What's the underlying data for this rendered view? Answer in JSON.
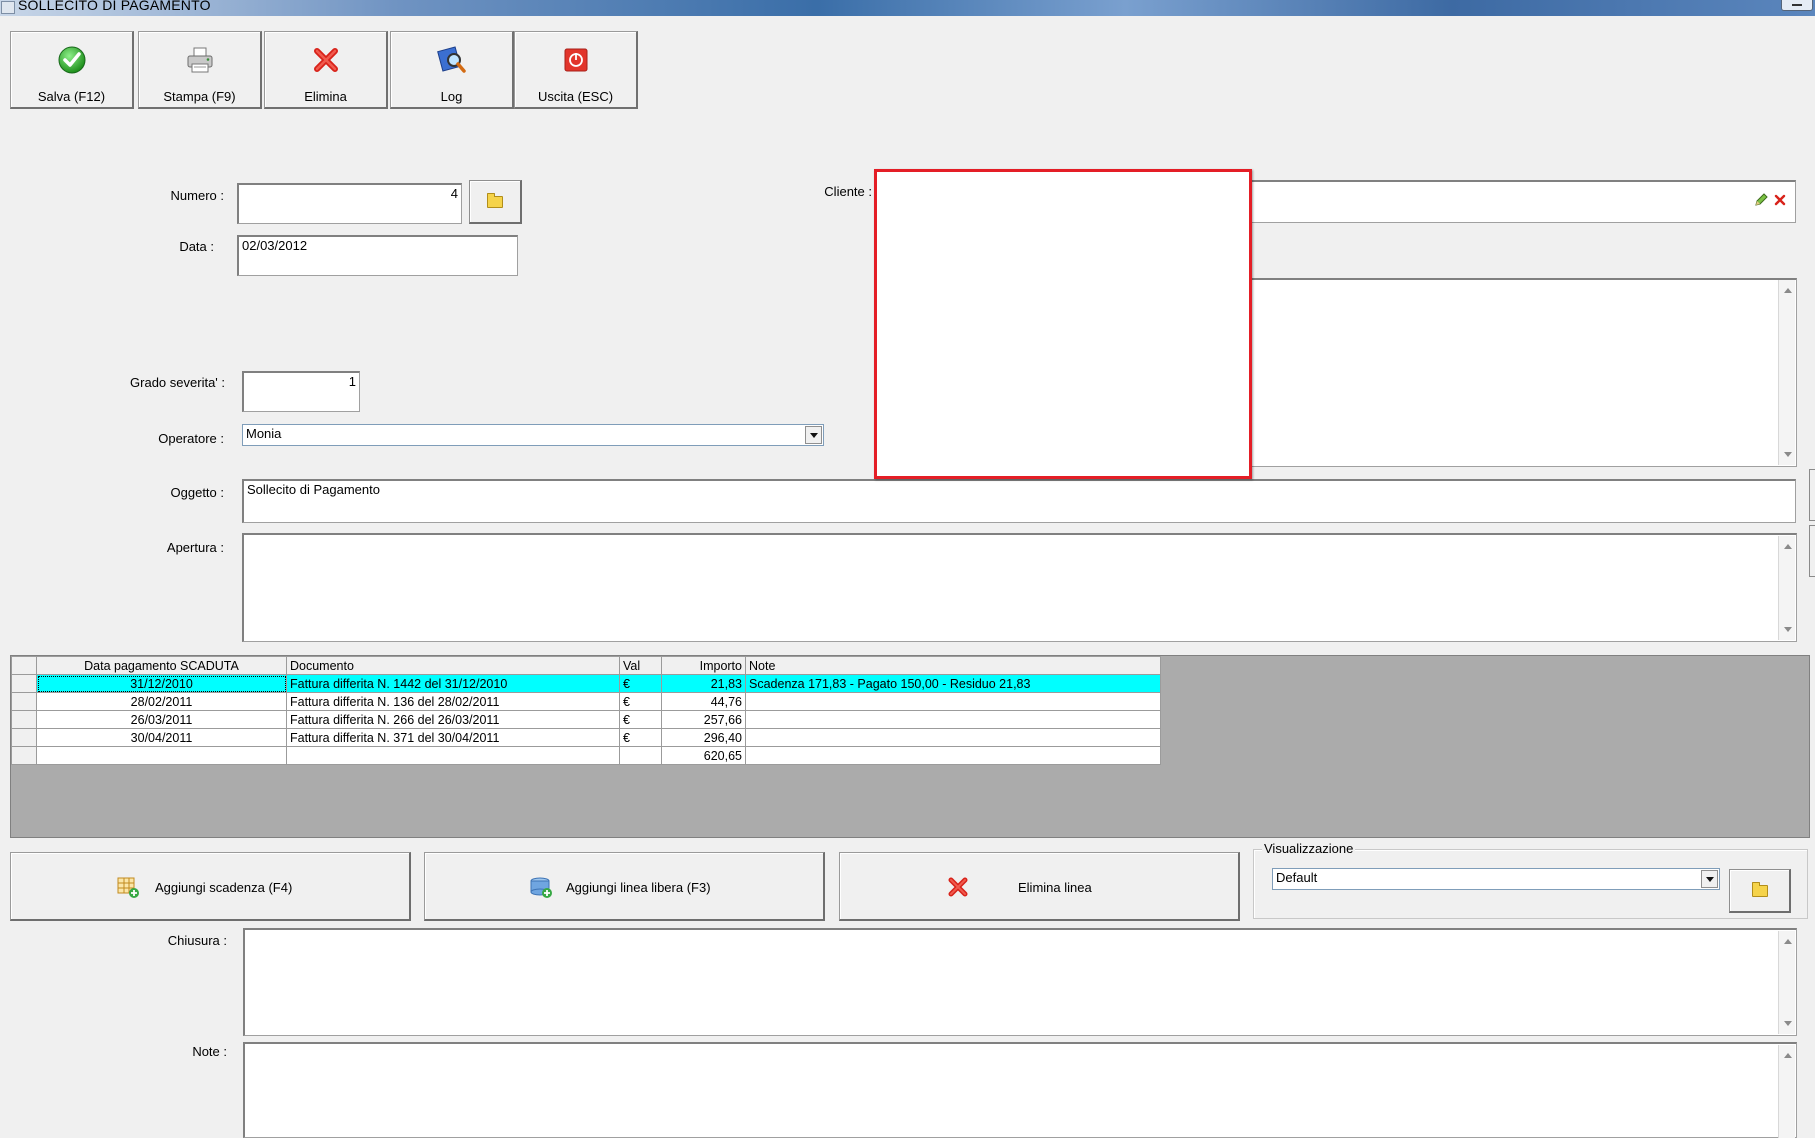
{
  "window": {
    "title": "SOLLECITO DI PAGAMENTO"
  },
  "toolbar": {
    "buttons": [
      {
        "label": "Salva (F12)",
        "icon": "check-icon"
      },
      {
        "label": "Stampa (F9)",
        "icon": "printer-icon"
      },
      {
        "label": "Elimina",
        "icon": "delete-x-icon"
      },
      {
        "label": "Log",
        "icon": "magnifier-icon"
      },
      {
        "label": "Uscita (ESC)",
        "icon": "exit-icon"
      }
    ]
  },
  "form": {
    "numero": {
      "label": "Numero :",
      "value": "4"
    },
    "data": {
      "label": "Data :",
      "value": "02/03/2012"
    },
    "cliente": {
      "label": "Cliente :",
      "value": ""
    },
    "grado": {
      "label": "Grado severita' :",
      "value": "1"
    },
    "operatore": {
      "label": "Operatore :",
      "value": "Monia"
    },
    "oggetto": {
      "label": "Oggetto :",
      "value": "Sollecito di Pagamento"
    },
    "apertura": {
      "label": "Apertura :",
      "value": ""
    },
    "chiusura": {
      "label": "Chiusura :",
      "value": ""
    },
    "note": {
      "label": "Note :",
      "value": ""
    }
  },
  "grid": {
    "columns": [
      "Data pagamento SCADUTA",
      "Documento",
      "Val",
      "Importo",
      "Note"
    ],
    "rows": [
      {
        "data": "31/12/2010",
        "documento": "Fattura differita N. 1442 del 31/12/2010",
        "val": "€",
        "importo": "21,83",
        "note": "Scadenza 171,83 - Pagato 150,00 - Residuo 21,83"
      },
      {
        "data": "28/02/2011",
        "documento": "Fattura differita N. 136 del 28/02/2011",
        "val": "€",
        "importo": "44,76",
        "note": ""
      },
      {
        "data": "26/03/2011",
        "documento": "Fattura differita N. 266 del 26/03/2011",
        "val": "€",
        "importo": "257,66",
        "note": ""
      },
      {
        "data": "30/04/2011",
        "documento": "Fattura differita N. 371 del 30/04/2011",
        "val": "€",
        "importo": "296,40",
        "note": ""
      }
    ],
    "total": "620,65",
    "selected_row": 0
  },
  "actions": {
    "aggiungi_scadenza": "Aggiungi scadenza (F4)",
    "aggiungi_linea": "Aggiungi linea libera (F3)",
    "elimina_linea": "Elimina linea"
  },
  "visualizzazione": {
    "title": "Visualizzazione",
    "value": "Default"
  },
  "colors": {
    "highlight": "#00ffff",
    "redact_border": "#e41e26",
    "grid_background": "#ababab"
  }
}
